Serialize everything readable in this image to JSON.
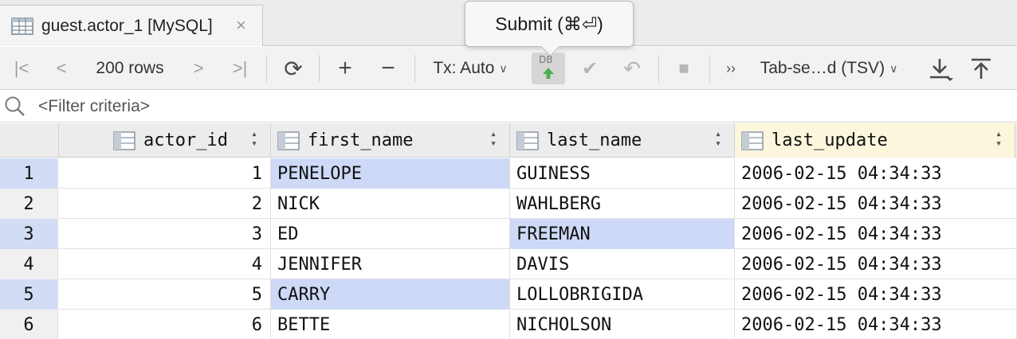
{
  "tab": {
    "title": "guest.actor_1 [MySQL]",
    "close": "×"
  },
  "tooltip": {
    "text": "Submit (⌘⏎)"
  },
  "toolbar": {
    "first": "|<",
    "prev": "<",
    "rows_label": "200 rows",
    "next": ">",
    "last": ">|",
    "refresh": "⟳",
    "add": "+",
    "remove": "−",
    "tx_label": "Tx: Auto",
    "db_badge": "DB",
    "commit": "✔",
    "rollback": "↶",
    "stop": "■",
    "more": "››",
    "export_format": "Tab-se…d (TSV)"
  },
  "filter": {
    "placeholder": "<Filter criteria>"
  },
  "table": {
    "columns": [
      "actor_id",
      "first_name",
      "last_name",
      "last_update"
    ],
    "rows": [
      {
        "n": "1",
        "actor_id": "1",
        "first_name": "PENELOPE",
        "last_name": "GUINESS",
        "last_update": "2006-02-15 04:34:33"
      },
      {
        "n": "2",
        "actor_id": "2",
        "first_name": "NICK",
        "last_name": "WAHLBERG",
        "last_update": "2006-02-15 04:34:33"
      },
      {
        "n": "3",
        "actor_id": "3",
        "first_name": "ED",
        "last_name": "FREEMAN",
        "last_update": "2006-02-15 04:34:33"
      },
      {
        "n": "4",
        "actor_id": "4",
        "first_name": "JENNIFER",
        "last_name": "DAVIS",
        "last_update": "2006-02-15 04:34:33"
      },
      {
        "n": "5",
        "actor_id": "5",
        "first_name": "CARRY",
        "last_name": "LOLLOBRIGIDA",
        "last_update": "2006-02-15 04:34:33"
      },
      {
        "n": "6",
        "actor_id": "6",
        "first_name": "BETTE",
        "last_name": "NICHOLSON",
        "last_update": "2006-02-15 04:34:33"
      }
    ]
  },
  "colors": {
    "selection": "#cdd9f7",
    "header_selected": "#fbf6dc",
    "commit_arrow": "#4caf50"
  }
}
